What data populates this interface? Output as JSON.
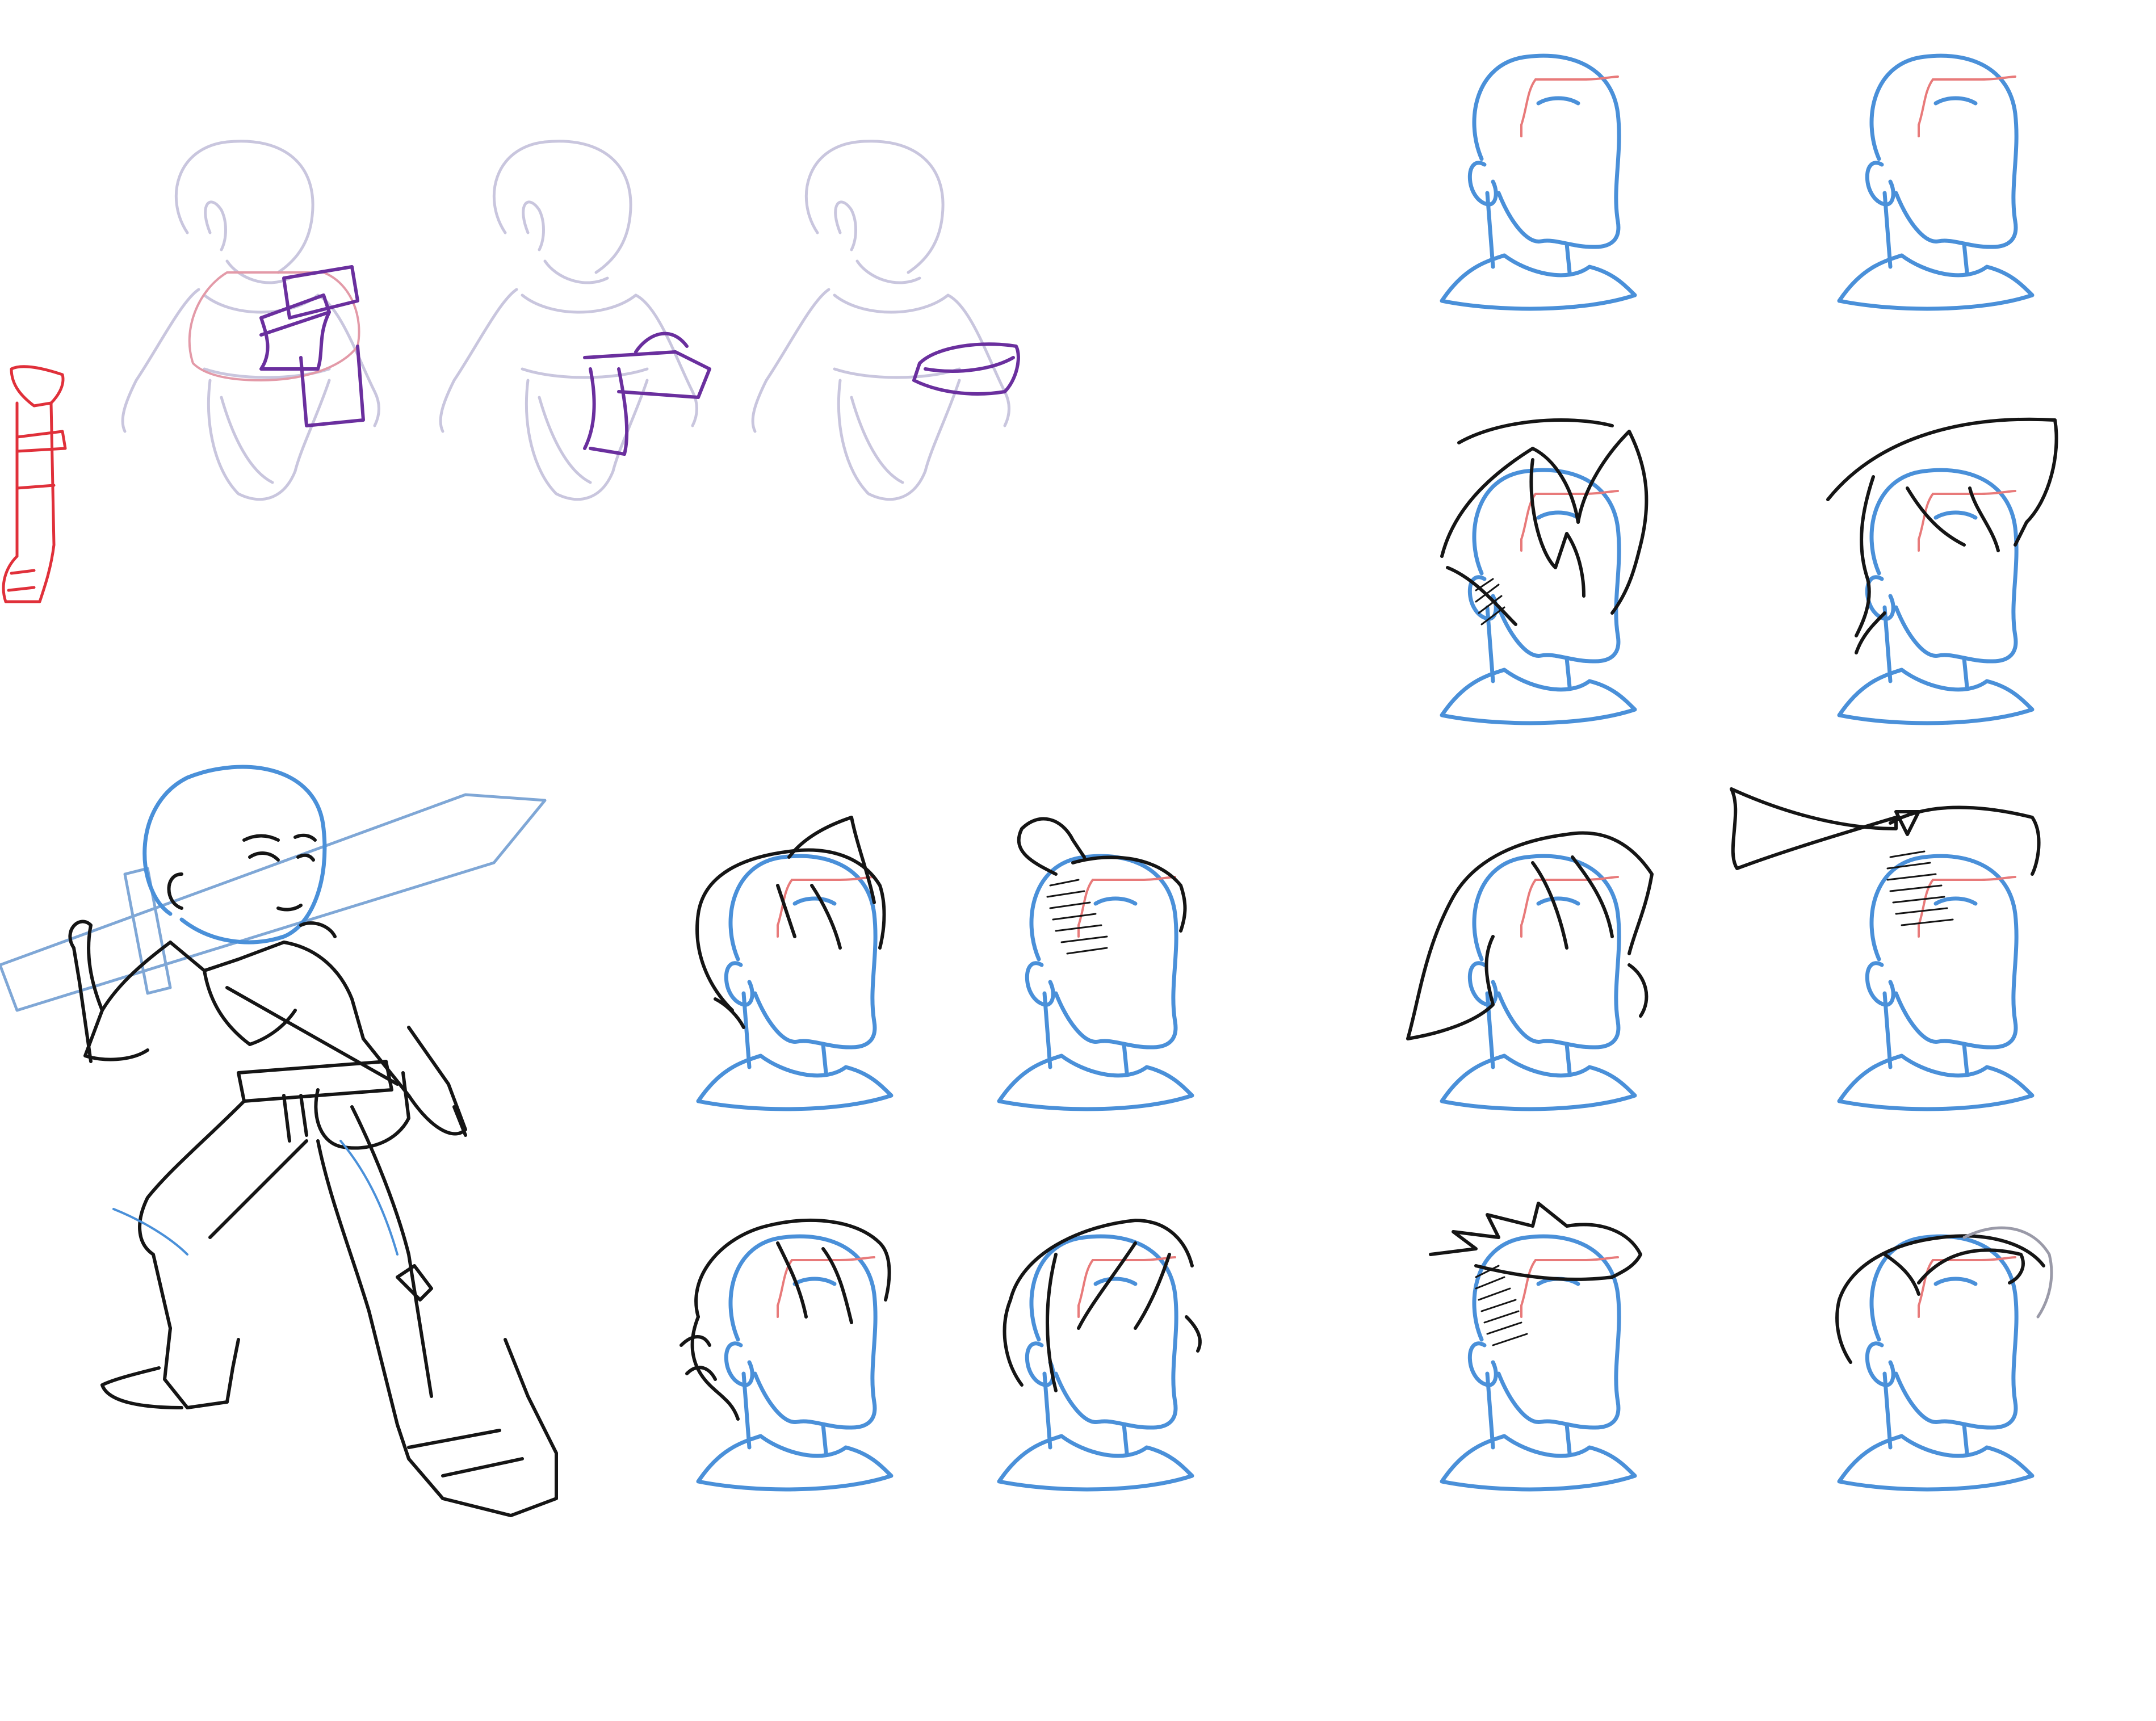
{
  "palette": {
    "background": "#ffffff",
    "construction_blue": "#4a90d9",
    "guide_red": "#e87a7a",
    "ink_black": "#151515",
    "lavender_sketch": "#c9c6de",
    "scarf_purple": "#6a2f9e",
    "red_leg_sketch": "#e0303a"
  },
  "heads": [
    {
      "style": "bald"
    },
    {
      "style": "bald"
    },
    {
      "style": "swept-tall"
    },
    {
      "style": "swept-side"
    },
    {
      "style": "messy-short"
    },
    {
      "style": "topknot-undercut"
    },
    {
      "style": "side-ponytail"
    },
    {
      "style": "long-ponytail"
    },
    {
      "style": "fluffy-curly"
    },
    {
      "style": "wavy-side"
    },
    {
      "style": "spiky-undercut"
    },
    {
      "style": "loose-layered"
    }
  ],
  "figures": [
    {
      "name": "torso-with-cape"
    },
    {
      "name": "torso-with-scarf"
    },
    {
      "name": "torso-with-collar"
    },
    {
      "name": "swordsman-pose"
    },
    {
      "name": "red-leg-sketch"
    }
  ]
}
